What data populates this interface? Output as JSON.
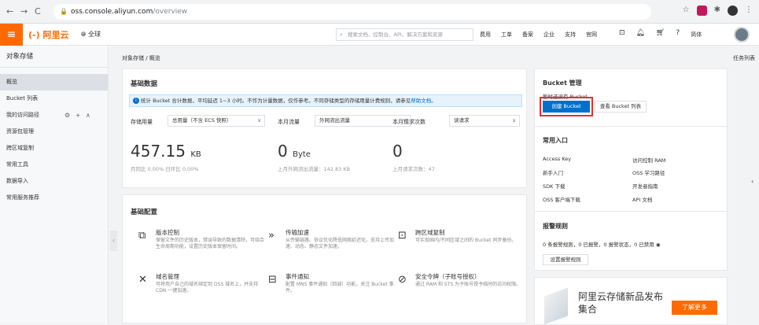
{
  "browser": {
    "url_domain": "oss.console.aliyun.com",
    "url_path": "/overview"
  },
  "topbar": {
    "menu_icon": "hamburger-icon",
    "logo": "(-) 阿里云",
    "region": "全球",
    "search_placeholder": "搜索文档、控制台、API、解决方案和资源",
    "links": [
      "费用",
      "工单",
      "备案",
      "企业",
      "支持",
      "官网"
    ],
    "lang": "简体"
  },
  "sidebar": {
    "title": "对象存储",
    "items": [
      "概览",
      "Bucket 列表",
      "我的访问路径",
      "资源包管理",
      "跨区域复制",
      "常用工具",
      "数据导入",
      "常用服务推荐"
    ],
    "access_extra": "⚙ + ∧"
  },
  "breadcrumb": "对象存储 / 概览",
  "task_list": "任务列表",
  "basic_data": {
    "title": "基础数据",
    "notice": "统计 Bucket 合计数据，平均延迟 1~3 小时。不作为计量数据，仅作参考。不同存储类型的存储用量计费规则，请参见",
    "notice_link": "帮助文档。",
    "stats": [
      {
        "label": "存储用量",
        "select": "总用量（不含 ECS 快照）",
        "value": "457.15",
        "unit": "KB",
        "sub": "月同比 0.00%  日环比 0.00%"
      },
      {
        "label": "本月流量",
        "select": "外网流出流量",
        "value": "0",
        "unit": "Byte",
        "sub": "上月外网流出流量：142.83 KB"
      },
      {
        "label": "本月请求次数",
        "select": "读请求",
        "value": "0",
        "unit": "",
        "sub": "上月请求次数：47"
      }
    ]
  },
  "basic_config": {
    "title": "基础配置",
    "features": [
      {
        "icon": "version-control-icon",
        "glyph": "⧉",
        "title": "版本控制",
        "desc": "保留文件的历史版本，错误导致的数据清除，可结合生命周期功能，设置历史版本保留时间。"
      },
      {
        "icon": "transfer-accel-icon",
        "glyph": "»",
        "title": "传输加速",
        "desc": "从传输链路、协议优化降低网络延迟化，支持上传加速、动态、静态文件加速。"
      },
      {
        "icon": "cross-region-icon",
        "glyph": "⊡",
        "title": "跨区域复制",
        "desc": "可实现国内/不同区域之间的 Bucket 同步备份。"
      },
      {
        "icon": "domain-icon",
        "glyph": "✕",
        "title": "域名管理",
        "desc": "可将用户自己的域名绑定到 OSS 域名上，并支持 CDN 一键加速。"
      },
      {
        "icon": "event-notify-icon",
        "glyph": "⊟",
        "title": "事件通知",
        "desc": "配置 MNS 事件通知（回调）功能，关注 Bucket 事件。"
      },
      {
        "icon": "security-token-icon",
        "glyph": "⊘",
        "title": "安全令牌（子账号授权）",
        "desc": "通过 RAM 和 STS 为子账号授予临时的访问权限。"
      }
    ]
  },
  "bucket_mgmt": {
    "title": "Bucket 管理",
    "empty": "暂时还没有 Bucket",
    "create": "创建 Bucket",
    "view": "查看 Bucket 列表"
  },
  "quick_entry": {
    "title": "常用入口",
    "links": [
      "Access Key",
      "访问控制 RAM",
      "新手入门",
      "OSS 学习路径",
      "SDK 下载",
      "开发者指南",
      "OSS 客户端下载",
      "API 文档"
    ]
  },
  "alarm": {
    "title": "报警规则",
    "summary": "0 条报警规则，0 已报警，0 报警状态，0 已禁用",
    "button": "设置报警规则"
  },
  "banner": {
    "text": "阿里云存储新品发布集合",
    "cta": "了解更多"
  },
  "colors": {
    "accent": "#ff6a00",
    "primary": "#0070cc",
    "highlight": "#e62e2e"
  }
}
